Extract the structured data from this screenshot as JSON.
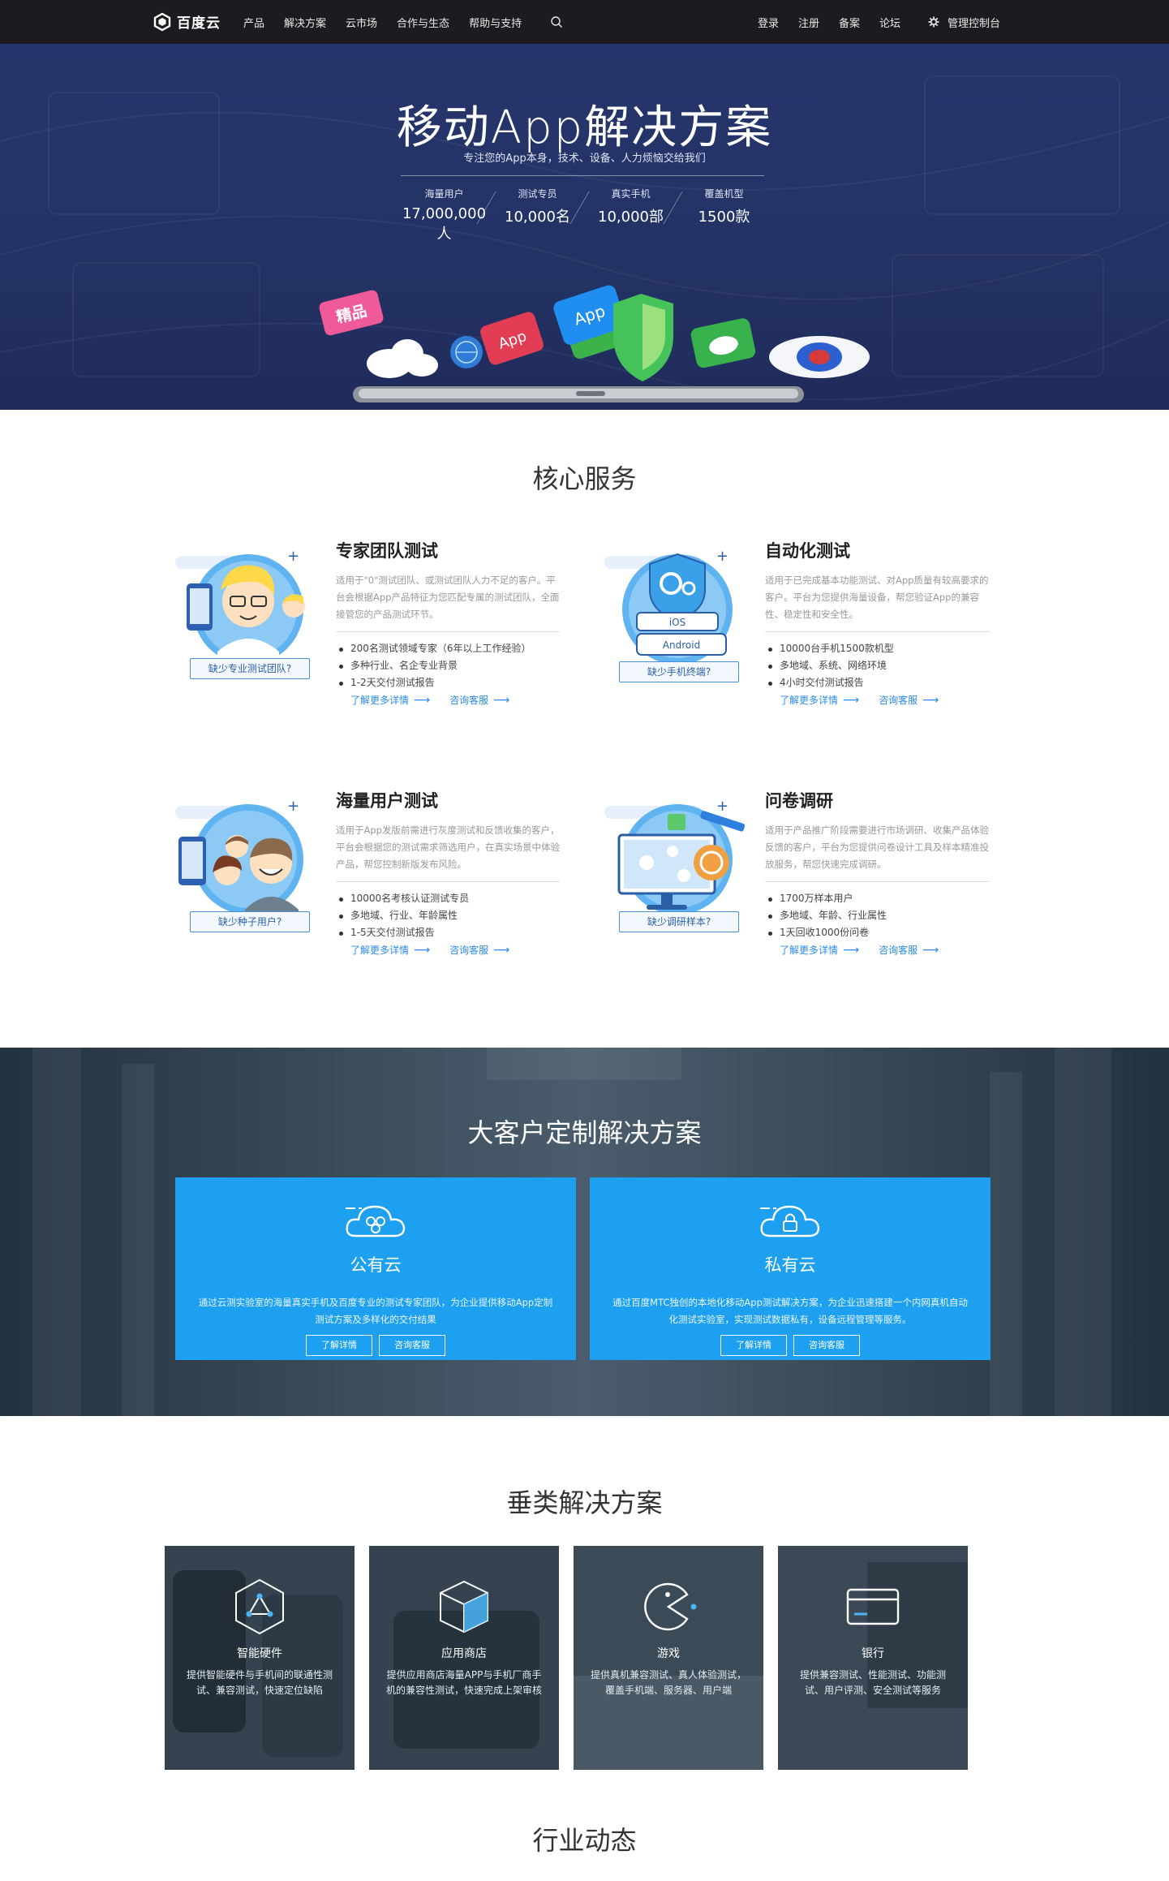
{
  "nav": {
    "logo_text": "百度云",
    "left_items": [
      "产品",
      "解决方案",
      "云市场",
      "合作与生态",
      "帮助与支持"
    ],
    "right_items": [
      "登录",
      "注册",
      "备案",
      "论坛"
    ],
    "console_label": "管理控制台"
  },
  "hero": {
    "title": "移动App解决方案",
    "subtitle": "专注您的App本身，技术、设备、人力烦恼交给我们",
    "stats": [
      {
        "label": "海量用户",
        "value": "17,000,000人"
      },
      {
        "label": "测试专员",
        "value": "10,000名"
      },
      {
        "label": "真实手机",
        "value": "10,000部"
      },
      {
        "label": "覆盖机型",
        "value": "1500款"
      }
    ],
    "art_labels": {
      "app": "App",
      "badge": "精品"
    }
  },
  "core": {
    "title": "核心服务",
    "services": [
      {
        "title": "专家团队测试",
        "desc": "适用于\"0\"测试团队、或测试团队人力不足的客户。平台会根据App产品特征为您匹配专属的测试团队，全面接管您的产品测试环节。",
        "items": [
          "200名测试领域专家（6年以上工作经验）",
          "多种行业、名企专业背景",
          "1-2天交付测试报告"
        ],
        "tag": "缺少专业测试团队?",
        "link_more": "了解更多详情",
        "link_consult": "咨询客服"
      },
      {
        "title": "自动化测试",
        "desc": "适用于已完成基本功能测试、对App质量有较高要求的客户。平台为您提供海量设备，帮您验证App的兼容性、稳定性和安全性。",
        "items": [
          "10000台手机1500款机型",
          "多地域、系统、网络环境",
          "4小时交付测试报告"
        ],
        "tag": "缺少手机终端?",
        "link_more": "了解更多详情",
        "link_consult": "咨询客服",
        "illus_labels": [
          "iOS",
          "Android"
        ]
      },
      {
        "title": "海量用户测试",
        "desc": "适用于App发版前需进行灰度测试和反馈收集的客户，平台会根据您的测试需求筛选用户，在真实场景中体验产品，帮您控制新版发布风险。",
        "items": [
          "10000名考核认证测试专员",
          "多地域、行业、年龄属性",
          "1-5天交付测试报告"
        ],
        "tag": "缺少种子用户?",
        "link_more": "了解更多详情",
        "link_consult": "咨询客服"
      },
      {
        "title": "问卷调研",
        "desc": "适用于产品推广阶段需要进行市场调研、收集产品体验反馈的客户，平台为您提供问卷设计工具及样本精准投放服务，帮您快速完成调研。",
        "items": [
          "1700万样本用户",
          "多地域、年龄、行业属性",
          "1天回收1000份问卷"
        ],
        "tag": "缺少调研样本?",
        "link_more": "了解更多详情",
        "link_consult": "咨询客服"
      }
    ]
  },
  "enterprise": {
    "title": "大客户定制解决方案",
    "cards": [
      {
        "title": "公有云",
        "desc": "通过云测实验室的海量真实手机及百度专业的测试专家团队，为企业提供移动App定制测试方案及多样化的交付结果",
        "btn_detail": "了解详情",
        "btn_consult": "咨询客服"
      },
      {
        "title": "私有云",
        "desc": "通过百度MTC独创的本地化移动App测试解决方案，为企业迅速搭建一个内网真机自动化测试实验室，实现测试数据私有，设备远程管理等服务。",
        "btn_detail": "了解详情",
        "btn_consult": "咨询客服"
      }
    ]
  },
  "vertical": {
    "title": "垂类解决方案",
    "cards": [
      {
        "title": "智能硬件",
        "desc": "提供智能硬件与手机间的联通性测试、兼容测试，快速定位缺陷",
        "icon": "triangle-network-icon"
      },
      {
        "title": "应用商店",
        "desc": "提供应用商店海量APP与手机厂商手机的兼容性测试，快速完成上架审核",
        "icon": "cube-icon"
      },
      {
        "title": "游戏",
        "desc": "提供真机兼容测试、真人体验测试，覆盖手机端、服务器、用户端",
        "icon": "pacman-icon"
      },
      {
        "title": "银行",
        "desc": "提供兼容测试、性能测试、功能测试、用户评测、安全测试等服务",
        "icon": "bank-card-icon"
      }
    ]
  },
  "news": {
    "title": "行业动态"
  },
  "colors": {
    "nav_bg": "#1b1c20",
    "hero_bg": "#26356b",
    "accent_blue": "#1ea0f0",
    "link_blue": "#2b8be8",
    "section_dark": "#3a4a58"
  }
}
